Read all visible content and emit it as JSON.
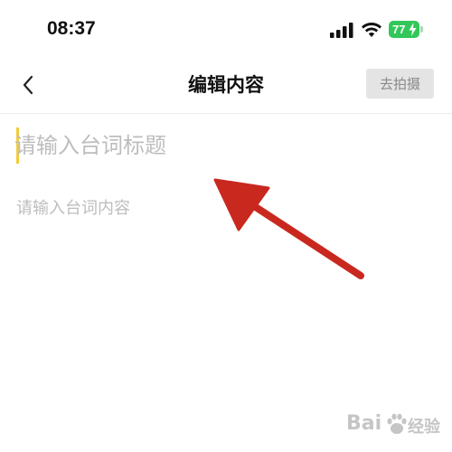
{
  "status_bar": {
    "time": "08:37",
    "battery": "77",
    "battery_color": "#33c759"
  },
  "nav": {
    "back_icon": "chevron-left-icon",
    "title": "编辑内容",
    "shoot_button": "去拍摄"
  },
  "editor": {
    "title_placeholder": "请输入台词标题",
    "title_value": "",
    "content_placeholder": "请输入台词内容",
    "content_value": "",
    "caret_color": "#f2cd3b"
  },
  "annotation": {
    "icon": "red-arrow",
    "color": "#c9281f"
  },
  "watermark": {
    "brand": "Bai",
    "brand_suffix": "经验"
  }
}
